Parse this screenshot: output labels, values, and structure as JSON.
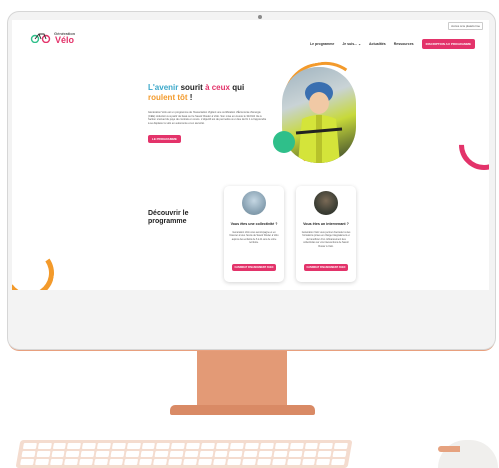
{
  "site": {
    "util_link": "Accès à la plateforme",
    "logo_small": "Génération",
    "logo_big": "Vélo",
    "nav": [
      "Le programme",
      "Je suis...",
      "Actualités",
      "Ressources"
    ],
    "nav_cta": "INSCRIPTION AU PROGRAMME"
  },
  "hero": {
    "title_part1": "L'avenir",
    "title_part2": "sourit",
    "title_part3": "à ceux",
    "title_part4": "qui",
    "title_part5": "roulent tôt",
    "title_part6": "!",
    "text": "Génération Vélo est un programme de l'Association Vigilent une certification d'Économie d'énergie (CEE) réduction à à partir de basé sur le Savoir Rouler à Vélo. Son mise en œuvre le 31/01/2 rite à l'action s'actuel du pays de contrats en cours. L'objectif est de permettre à un lieu de fin 1 à l'apprendre à se déplacer à vélo en autonomie et en sécurité.",
    "button": "LE PROGRAMME"
  },
  "discover": {
    "title": "Découvrir le programme",
    "cards": [
      {
        "title": "Vous êtes une collectivité ?",
        "text": "Génération Vélo vous accompagne et en financer à tous l'école de Savoir Rouler à Vélo auprès des enfants de 6 à 11 ans de votre territoire.",
        "button": "CANDIDAT FINANCEMENT AVEC"
      },
      {
        "title": "Vous êtes un intervenant ?",
        "text": "Génération Vélo vous permet d'accéder à des formations prises en charge intégralement et de bénéficier d'un cofinancement des collectivités sur vos interventions de Savoir Rouler à Vélo.",
        "button": "CANDIDAT FINANCEMENT AVEC"
      }
    ]
  },
  "colors": {
    "pink": "#e3336a",
    "orange": "#f39a2b",
    "blue": "#3aa7c9",
    "green": "#2fbf8a",
    "case": "#e8a07e"
  },
  "icons": [
    "bicycle-logo-icon",
    "chevron-down-icon",
    "webcam-icon"
  ]
}
